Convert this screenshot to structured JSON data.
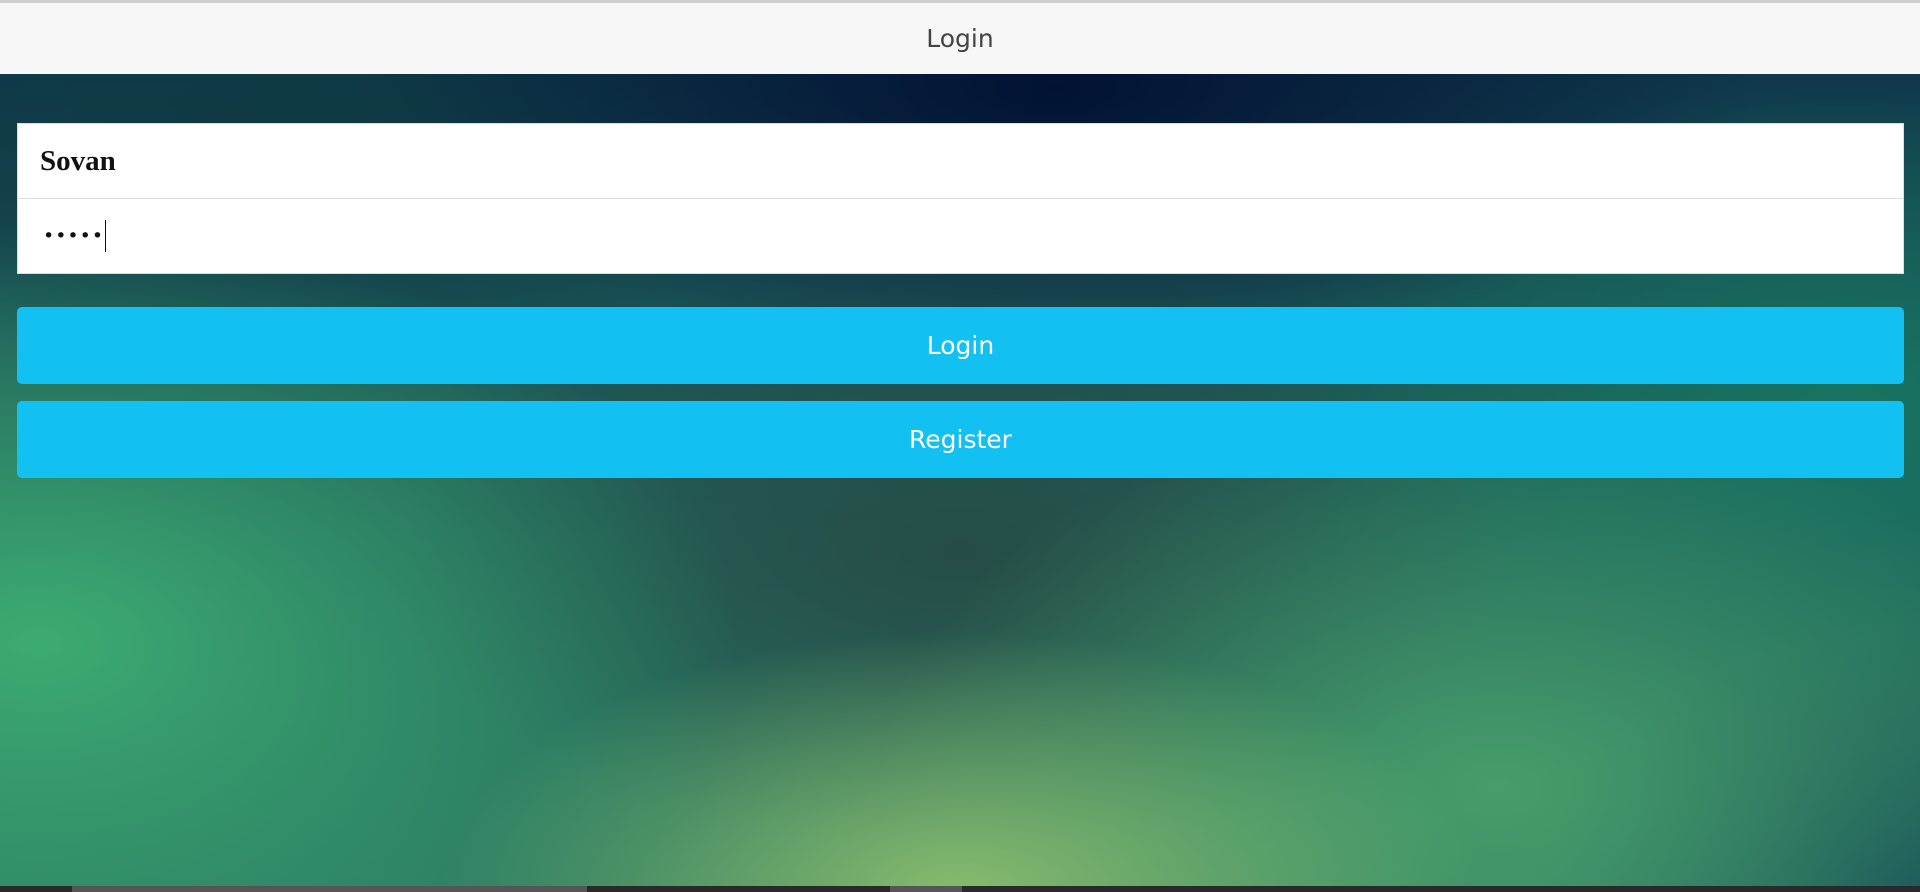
{
  "colors": {
    "header_bg": "#f7f7f7",
    "button_bg": "#12c1f2",
    "button_text": "#ffffff"
  },
  "header": {
    "title": "Login"
  },
  "form": {
    "username": {
      "value": "Sovan"
    },
    "password": {
      "masked_value": "•••••"
    }
  },
  "buttons": {
    "login_label": "Login",
    "register_label": "Register"
  }
}
